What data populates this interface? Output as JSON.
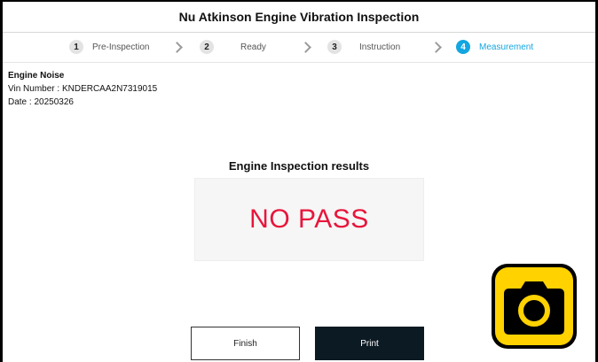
{
  "app": {
    "title": "Nu Atkinson Engine Vibration Inspection"
  },
  "stepper": {
    "steps": [
      {
        "number": "1",
        "label": "Pre-Inspection"
      },
      {
        "number": "2",
        "label": "Ready"
      },
      {
        "number": "3",
        "label": "Instruction"
      },
      {
        "number": "4",
        "label": "Measurement"
      }
    ],
    "active_step": 4
  },
  "inspection": {
    "type": "Engine Noise",
    "vin": "Vin Number : KNDERCAA2N7319015",
    "date": "Date : 20250326"
  },
  "results": {
    "title": "Engine Inspection results",
    "status": "NO PASS",
    "status_color": "#e8153c"
  },
  "actions": {
    "finish_label": "Finish",
    "print_label": "Print",
    "camera_icon": "camera-icon",
    "camera_color": "#ffd200"
  }
}
